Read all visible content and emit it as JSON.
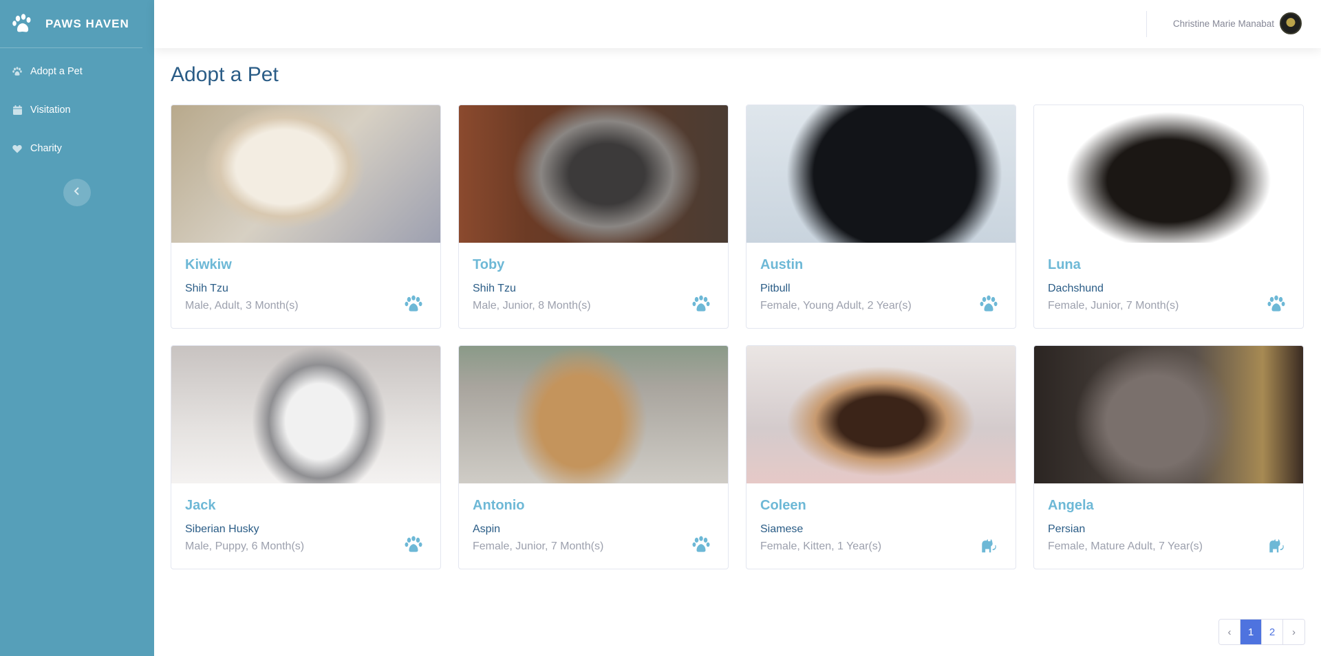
{
  "app": {
    "brand": "PAWS HAVEN",
    "accent_color": "#569fb9"
  },
  "sidebar": {
    "items": [
      {
        "label": "Adopt a Pet",
        "icon": "paw-icon"
      },
      {
        "label": "Visitation",
        "icon": "calendar-icon"
      },
      {
        "label": "Charity",
        "icon": "heart-icon"
      }
    ],
    "toggle_icon": "chevron-left-icon"
  },
  "topbar": {
    "user_name": "Christine Marie Manabat"
  },
  "main": {
    "title": "Adopt a Pet",
    "pets": [
      {
        "name": "Kiwkiw",
        "breed": "Shih Tzu",
        "info": "Male, Adult, 3 Month(s)",
        "type": "dog",
        "icon": "paw-icon"
      },
      {
        "name": "Toby",
        "breed": "Shih Tzu",
        "info": "Male, Junior, 8 Month(s)",
        "type": "dog",
        "icon": "paw-icon"
      },
      {
        "name": "Austin",
        "breed": "Pitbull",
        "info": "Female, Young Adult, 2 Year(s)",
        "type": "dog",
        "icon": "paw-icon"
      },
      {
        "name": "Luna",
        "breed": "Dachshund",
        "info": "Female, Junior, 7 Month(s)",
        "type": "dog",
        "icon": "paw-icon"
      },
      {
        "name": "Jack",
        "breed": "Siberian Husky",
        "info": "Male, Puppy, 6 Month(s)",
        "type": "dog",
        "icon": "paw-icon"
      },
      {
        "name": "Antonio",
        "breed": "Aspin",
        "info": "Female, Junior, 7 Month(s)",
        "type": "dog",
        "icon": "paw-icon"
      },
      {
        "name": "Coleen",
        "breed": "Siamese",
        "info": "Female, Kitten, 1 Year(s)",
        "type": "cat",
        "icon": "cat-icon"
      },
      {
        "name": "Angela",
        "breed": "Persian",
        "info": "Female, Mature Adult, 7 Year(s)",
        "type": "cat",
        "icon": "cat-icon"
      }
    ]
  },
  "pagination": {
    "prev": "‹",
    "pages": [
      "1",
      "2"
    ],
    "current": "1",
    "next": "›"
  }
}
